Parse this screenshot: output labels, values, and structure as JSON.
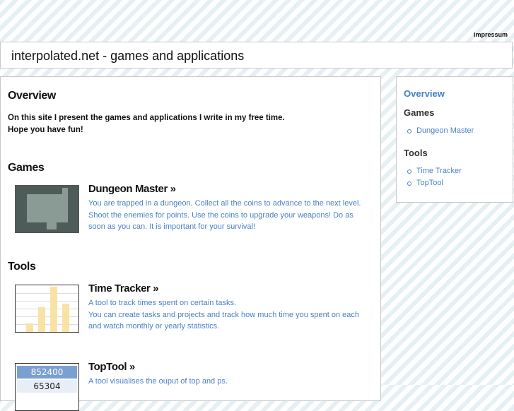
{
  "header": {
    "impressum_link": "impressum",
    "site_title": "interpolated.net - games and applications"
  },
  "main": {
    "overview_heading": "Overview",
    "intro_lines": [
      "On this site I present the games and applications I write in my free time.",
      "Hope you have fun!"
    ],
    "games_heading": "Games",
    "tools_heading": "Tools",
    "dungeon_master": {
      "title": "Dungeon Master »",
      "desc_lines": [
        "You are trapped in a dungeon. Collect all the coins to advance to the next level.",
        "Shoot the enemies for points. Use the coins to upgrade your weapons! Do as",
        "soon as you can. It is important for your survival!"
      ]
    },
    "time_tracker": {
      "title": "Time Tracker »",
      "desc_lines": [
        "A tool to track times spent on certain tasks.",
        "You can create tasks and projects and track how much time you spent on each",
        "and watch monthly or yearly statistics."
      ],
      "thumb_bar_levels": [
        0.18,
        0.55,
        1.0,
        0.62
      ]
    },
    "toptool": {
      "title": "TopTool »",
      "desc_lines": [
        "A tool visualises the ouput of top and ps."
      ],
      "thumb_values": [
        "852400",
        "65304"
      ]
    }
  },
  "sidebar": {
    "overview_link": "Overview",
    "games_heading": "Games",
    "games_items": [
      "Dungeon Master"
    ],
    "tools_heading": "Tools",
    "tools_items": [
      "Time Tracker",
      "TopTool"
    ]
  },
  "colors": {
    "link_blue": "#4a80c8",
    "stripe": "#e6eff2",
    "border": "#c8c8c8"
  }
}
